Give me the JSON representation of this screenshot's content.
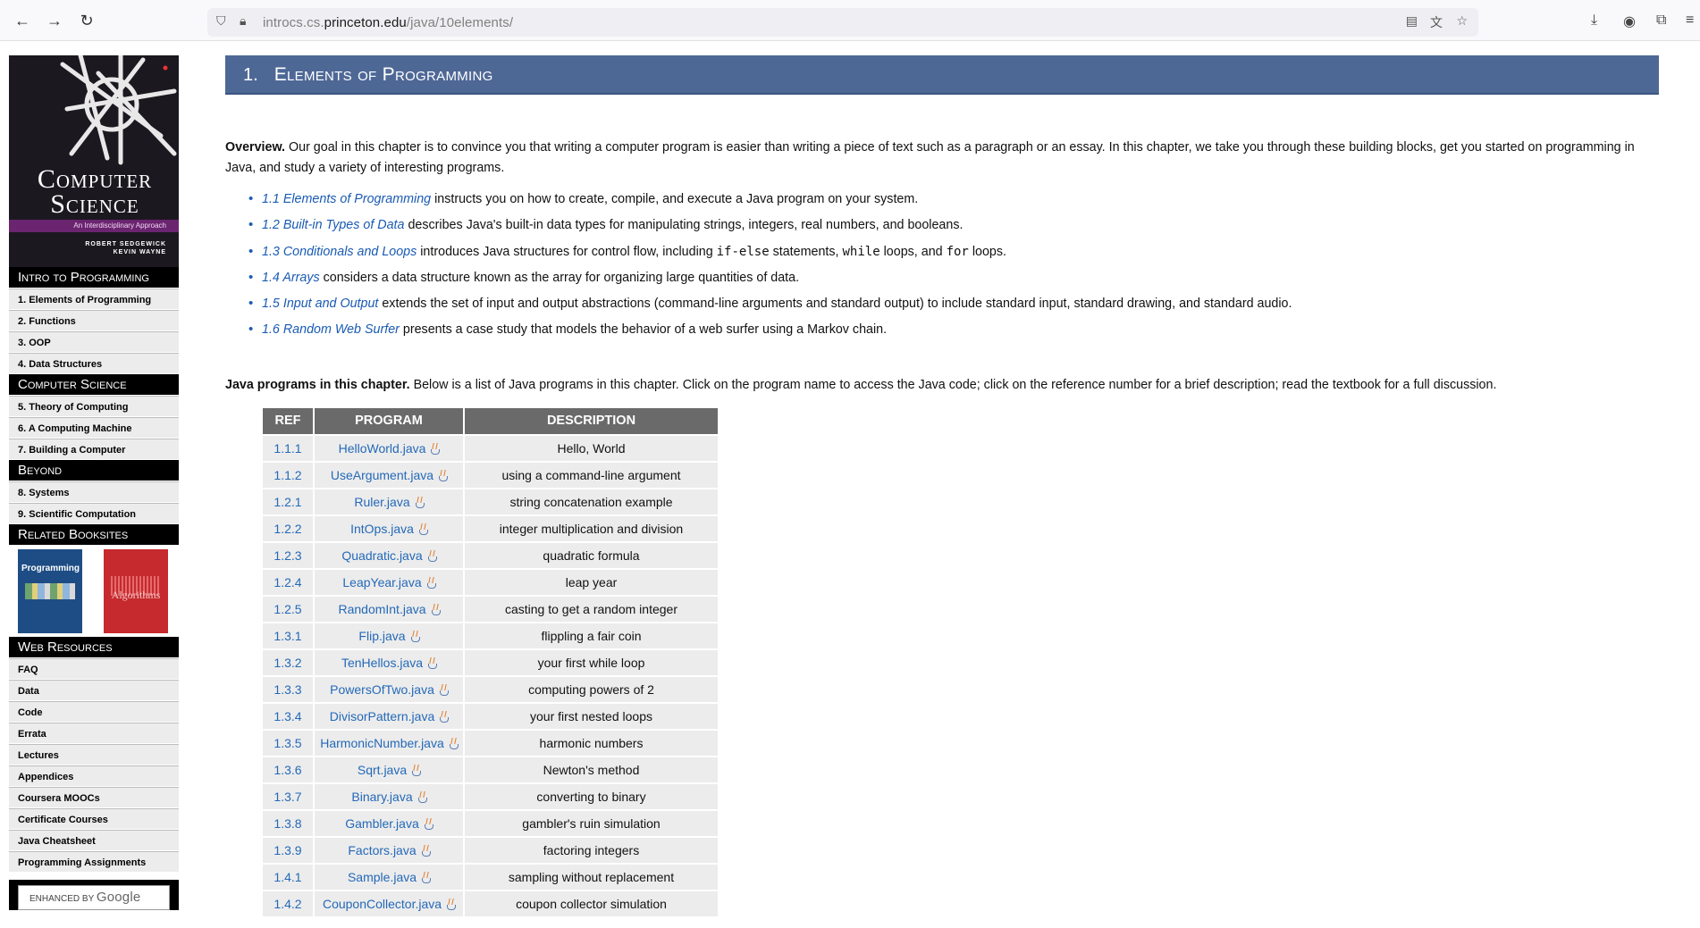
{
  "browser": {
    "url_prefix": "introcs.cs.",
    "url_domain": "princeton.edu",
    "url_path": "/java/10elements/"
  },
  "cover": {
    "title_line1": "Computer",
    "title_line2": "Science",
    "subtitle": "An Interdisciplinary Approach",
    "author1": "ROBERT SEDGEWICK",
    "author2": "KEVIN WAYNE"
  },
  "sidebar": {
    "sections": [
      {
        "title": "Intro to Programming",
        "items": [
          "1.  Elements of Programming",
          "2.  Functions",
          "3.  OOP",
          "4.  Data Structures"
        ]
      },
      {
        "title": "Computer Science",
        "items": [
          "5.  Theory of Computing",
          "6.  A Computing Machine",
          "7.  Building a Computer"
        ]
      },
      {
        "title": "Beyond",
        "items": [
          "8.  Systems",
          "9.  Scientific Computation"
        ]
      }
    ],
    "related_title": "Related Booksites",
    "book_python": "Programming",
    "book_algorithms": "Algorithms",
    "web_title": "Web Resources",
    "web_items": [
      "FAQ",
      "Data",
      "Code",
      "Errata",
      "Lectures",
      "Appendices",
      "Coursera MOOCs",
      "Certificate Courses",
      "Java Cheatsheet",
      "Programming Assignments"
    ],
    "search_prefix": "ENHANCED BY",
    "search_brand": "Google"
  },
  "page": {
    "chapter_num": "1.",
    "chapter_title": "Elements of Programming",
    "overview_label": "Overview.",
    "overview_text": " Our goal in this chapter is to convince you that writing a computer program is easier than writing a piece of text such as a paragraph or an essay. In this chapter, we take you through these building blocks, get you started on programming in Java, and study a variety of interesting programs.",
    "sections": [
      {
        "link": "1.1 Elements of Programming",
        "text": " instructs you on how to create, compile, and execute a Java program on your system."
      },
      {
        "link": "1.2 Built-in Types of Data",
        "text": " describes Java's built-in data types for manipulating strings, integers, real numbers, and booleans."
      },
      {
        "link": "1.3 Conditionals and Loops",
        "text_a": " introduces Java structures for control flow, including ",
        "code_a": "if-else",
        "text_b": " statements, ",
        "code_b": "while",
        "text_c": " loops, and ",
        "code_c": "for",
        "text_d": " loops."
      },
      {
        "link": "1.4 Arrays",
        "text": " considers a data structure known as the array for organizing large quantities of data."
      },
      {
        "link": "1.5 Input and Output",
        "text": " extends the set of input and output abstractions (command-line arguments and standard output) to include standard input, standard drawing, and standard audio."
      },
      {
        "link": "1.6 Random Web Surfer",
        "text": " presents a case study that models the behavior of a web surfer using a Markov chain."
      }
    ],
    "programs_label": "Java programs in this chapter.",
    "programs_text": " Below is a list of Java programs in this chapter. Click on the program name to access the Java code; click on the reference number for a brief description; read the textbook for a full discussion."
  },
  "table": {
    "headers": [
      "REF",
      "PROGRAM",
      "DESCRIPTION"
    ],
    "rows": [
      [
        "1.1.1",
        "HelloWorld.java",
        "Hello, World"
      ],
      [
        "1.1.2",
        "UseArgument.java",
        "using a command-line argument"
      ],
      [
        "1.2.1",
        "Ruler.java",
        "string concatenation example"
      ],
      [
        "1.2.2",
        "IntOps.java",
        "integer multiplication and division"
      ],
      [
        "1.2.3",
        "Quadratic.java",
        "quadratic formula"
      ],
      [
        "1.2.4",
        "LeapYear.java",
        "leap year"
      ],
      [
        "1.2.5",
        "RandomInt.java",
        "casting to get a random integer"
      ],
      [
        "1.3.1",
        "Flip.java",
        "flippling a fair coin"
      ],
      [
        "1.3.2",
        "TenHellos.java",
        "your first while loop"
      ],
      [
        "1.3.3",
        "PowersOfTwo.java",
        "computing powers of 2"
      ],
      [
        "1.3.4",
        "DivisorPattern.java",
        "your first nested loops"
      ],
      [
        "1.3.5",
        "HarmonicNumber.java",
        "harmonic numbers"
      ],
      [
        "1.3.6",
        "Sqrt.java",
        "Newton's method"
      ],
      [
        "1.3.7",
        "Binary.java",
        "converting to binary"
      ],
      [
        "1.3.8",
        "Gambler.java",
        "gambler's ruin simulation"
      ],
      [
        "1.3.9",
        "Factors.java",
        "factoring integers"
      ],
      [
        "1.4.1",
        "Sample.java",
        "sampling without replacement"
      ],
      [
        "1.4.2",
        "CouponCollector.java",
        "coupon collector simulation"
      ]
    ]
  }
}
